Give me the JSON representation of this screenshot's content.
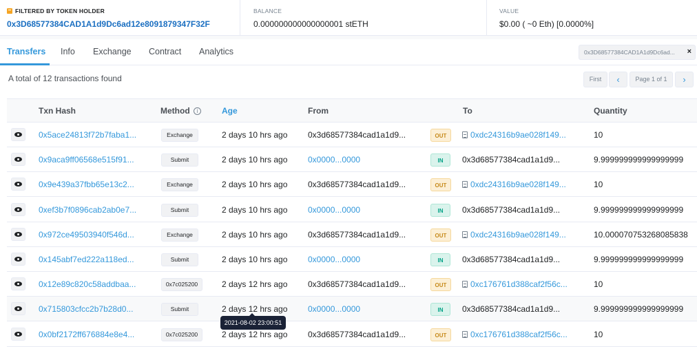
{
  "header": {
    "filter_label": "FILTERED BY TOKEN HOLDER",
    "filter_address": "0x3D68577384CAD1A1d9Dc6ad12e8091879347F32F",
    "balance_label": "BALANCE",
    "balance_value": "0.000000000000000001 stETH",
    "value_label": "VALUE",
    "value_value": "$0.00 ( ~0 Eth) [0.0000%]"
  },
  "tabs": [
    "Transfers",
    "Info",
    "Exchange",
    "Contract",
    "Analytics"
  ],
  "filter_pill": {
    "text": "0x3D68577384CAD1A1d9Dc6ad...",
    "close": "×"
  },
  "summary": "A total of 12 transactions found",
  "pager": {
    "first": "First",
    "prev": "‹",
    "page": "Page 1 of 1",
    "next": "›"
  },
  "columns": {
    "hash": "Txn Hash",
    "method": "Method",
    "method_info": "i",
    "age": "Age",
    "from": "From",
    "to": "To",
    "quantity": "Quantity"
  },
  "rows": [
    {
      "hash": "0x5ace24813f72b7faba1...",
      "method": "Exchange",
      "age": "2 days 10 hrs ago",
      "from": "0x3d68577384cad1a1d9...",
      "dir": "OUT",
      "to": "0xdc24316b9ae028f149...",
      "qty": "10"
    },
    {
      "hash": "0x9aca9ff06568e515f91...",
      "method": "Submit",
      "age": "2 days 10 hrs ago",
      "from": "0x0000...0000",
      "dir": "IN",
      "to": "0x3d68577384cad1a1d9...",
      "qty": "9.999999999999999999"
    },
    {
      "hash": "0x9e439a37fbb65e13c2...",
      "method": "Exchange",
      "age": "2 days 10 hrs ago",
      "from": "0x3d68577384cad1a1d9...",
      "dir": "OUT",
      "to": "0xdc24316b9ae028f149...",
      "qty": "10"
    },
    {
      "hash": "0xef3b7f0896cab2ab0e7...",
      "method": "Submit",
      "age": "2 days 10 hrs ago",
      "from": "0x0000...0000",
      "dir": "IN",
      "to": "0x3d68577384cad1a1d9...",
      "qty": "9.999999999999999999"
    },
    {
      "hash": "0x972ce49503940f546d...",
      "method": "Exchange",
      "age": "2 days 10 hrs ago",
      "from": "0x3d68577384cad1a1d9...",
      "dir": "OUT",
      "to": "0xdc24316b9ae028f149...",
      "qty": "10.000070753268085838"
    },
    {
      "hash": "0x145abf7ed222a118ed...",
      "method": "Submit",
      "age": "2 days 10 hrs ago",
      "from": "0x0000...0000",
      "dir": "IN",
      "to": "0x3d68577384cad1a1d9...",
      "qty": "9.999999999999999999"
    },
    {
      "hash": "0x12e89c820c58addbaa...",
      "method": "0x7c025200",
      "age": "2 days 12 hrs ago",
      "from": "0x3d68577384cad1a1d9...",
      "dir": "OUT",
      "to": "0xc176761d388caf2f56c...",
      "qty": "10"
    },
    {
      "hash": "0x715803cfcc2b7b28d0...",
      "method": "Submit",
      "age": "2 days 12 hrs ago",
      "from": "0x0000...0000",
      "dir": "IN",
      "to": "0x3d68577384cad1a1d9...",
      "qty": "9.999999999999999999"
    },
    {
      "hash": "0x0bf2172ff676884e8e4...",
      "method": "0x7c025200",
      "age": "2 days 12 hrs ago",
      "from": "0x3d68577384cad1a1d9...",
      "dir": "OUT",
      "to": "0xc176761d388caf2f56c...",
      "qty": "10"
    }
  ],
  "tooltip": "2021-08-02 23:00:51"
}
